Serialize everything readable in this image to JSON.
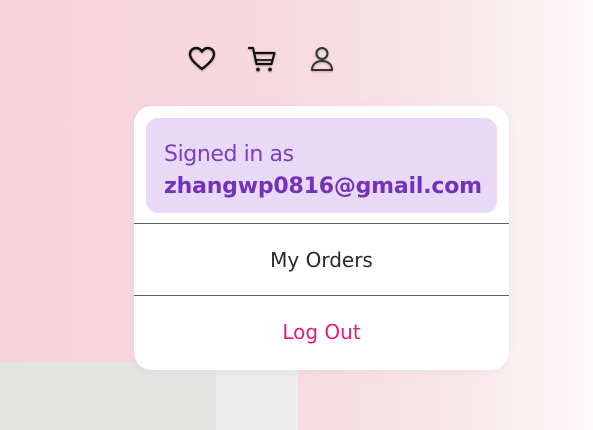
{
  "header": {
    "icons": {
      "wishlist": "heart-icon",
      "cart": "cart-icon",
      "account": "user-icon"
    }
  },
  "account_menu": {
    "signed_in_label": "Signed in as",
    "email": "zhangwp0816@gmail.com",
    "items": [
      {
        "label": "My Orders"
      },
      {
        "label": "Log Out"
      }
    ]
  },
  "colors": {
    "accent_purple": "#7332b8",
    "signed_box_bg": "#e8d9f6",
    "logout_pink": "#e01e78"
  }
}
